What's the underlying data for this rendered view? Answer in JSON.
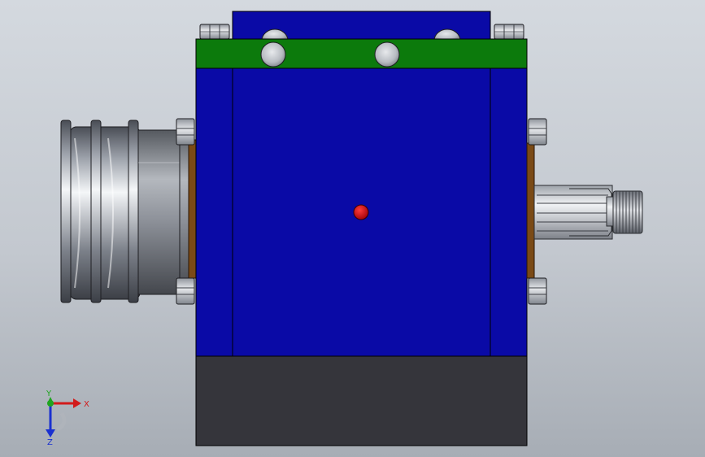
{
  "viewport": {
    "background_top": "#d4d9df",
    "background_bottom": "#a7adb5"
  },
  "model": {
    "housing_color": "#0a0aa6",
    "flange_color": "#0c7a0c",
    "base_color": "#35353b",
    "gasket_color": "#7a4a16",
    "center_marker_color": "#c40d12",
    "metal_color": "#9a9ea6"
  },
  "triad": {
    "x_label": "X",
    "y_label": "Y",
    "z_label": "Z",
    "x_color": "#d21a1a",
    "y_color": "#1fa51f",
    "z_color": "#1a30d0"
  }
}
